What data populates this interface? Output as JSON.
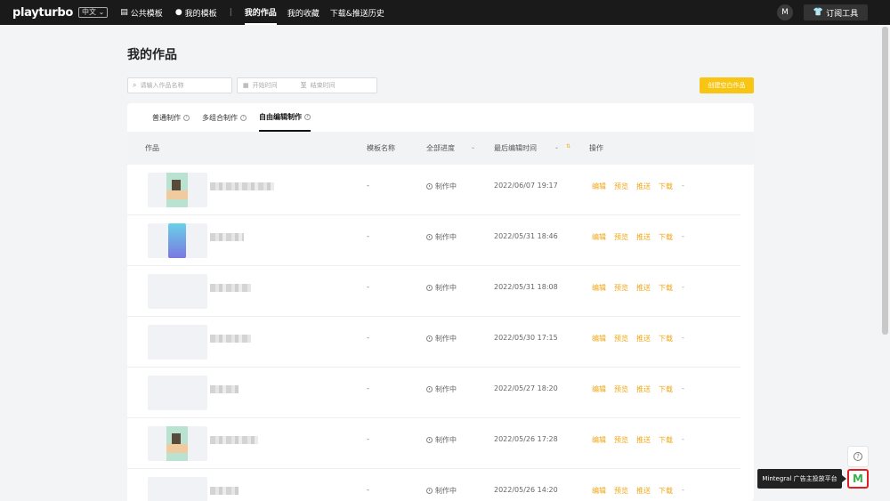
{
  "topbar": {
    "logo": "playturbo",
    "language": "中文",
    "nav": [
      {
        "label": "公共模板",
        "icon": "store-icon"
      },
      {
        "label": "我的模板",
        "icon": "user-icon"
      }
    ],
    "separator": "|",
    "tabs": [
      "我的作品",
      "我的收藏",
      "下载&推送历史"
    ],
    "active_tab": "我的作品",
    "avatar": "M",
    "subscribe_label": "订阅工具"
  },
  "page": {
    "title": "我的作品",
    "search_placeholder": "请输入作品名称",
    "date_start_placeholder": "开始时间",
    "date_separator": "至",
    "date_end_placeholder": "结束时间",
    "create_button": "创建空白作品"
  },
  "subtabs": [
    "普通制作",
    "多组合制作",
    "自由编辑制作"
  ],
  "active_subtab": "自由编辑制作",
  "table": {
    "headers": [
      "作品",
      "模板名称",
      "全部进度",
      "最后编辑时间",
      "操作"
    ],
    "actions": [
      "编辑",
      "预览",
      "推送",
      "下载",
      "-"
    ],
    "rows": [
      {
        "template": "-",
        "status": "制作中",
        "time": "2022/06/07 19:17"
      },
      {
        "template": "-",
        "status": "制作中",
        "time": "2022/05/31 18:46"
      },
      {
        "template": "-",
        "status": "制作中",
        "time": "2022/05/31 18:08"
      },
      {
        "template": "-",
        "status": "制作中",
        "time": "2022/05/30 17:15"
      },
      {
        "template": "-",
        "status": "制作中",
        "time": "2022/05/27 18:20"
      },
      {
        "template": "-",
        "status": "制作中",
        "time": "2022/05/26 17:28"
      },
      {
        "template": "-",
        "status": "制作中",
        "time": "2022/05/26 14:20"
      }
    ]
  },
  "floating": {
    "help_icon": "question-icon",
    "tooltip": "Mintegral 广告主投放平台",
    "mintegral_logo": "M"
  },
  "colors": {
    "topbar": "#1a1a1a",
    "accent": "#f8c514",
    "action_link": "#f0a616",
    "highlight_border": "#e02020"
  }
}
